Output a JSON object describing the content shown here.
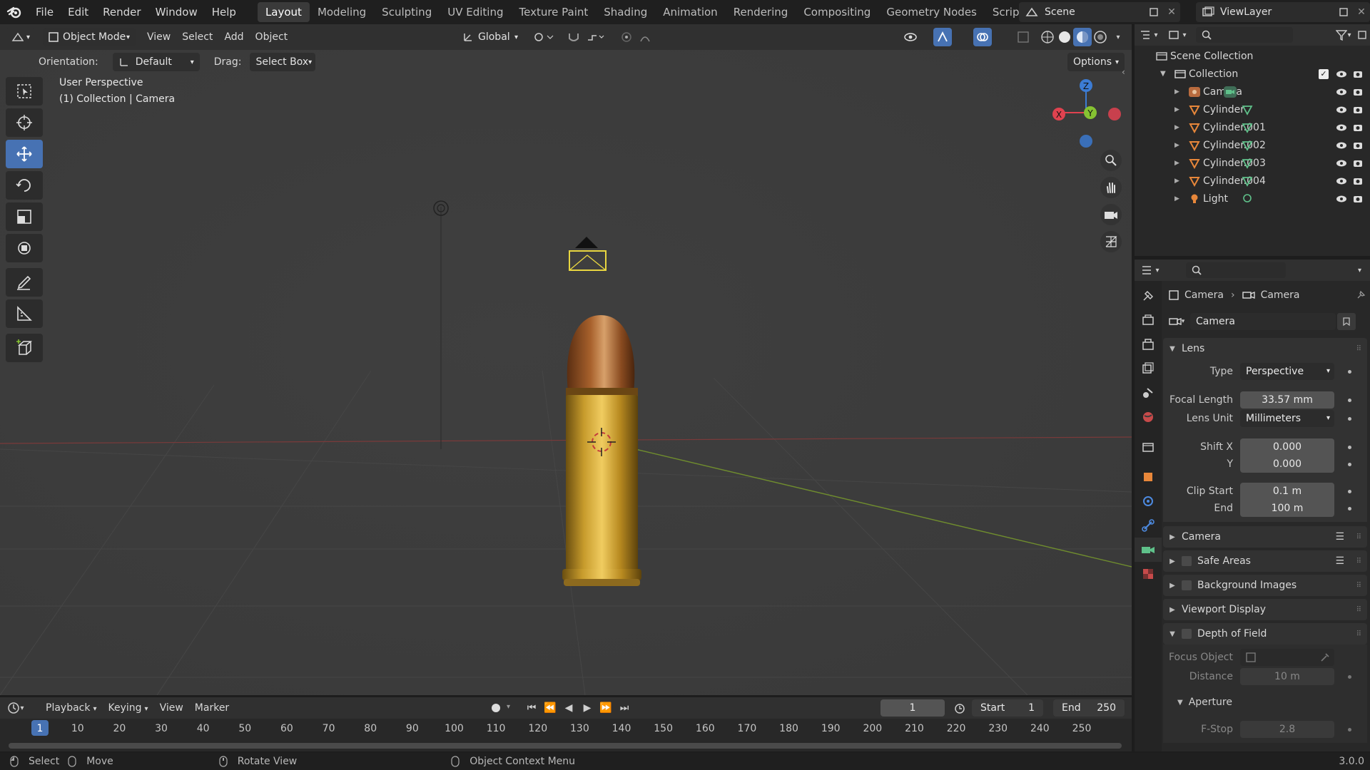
{
  "topbar": {
    "menus": [
      "File",
      "Edit",
      "Render",
      "Window",
      "Help"
    ],
    "workspaces": [
      "Layout",
      "Modeling",
      "Sculpting",
      "UV Editing",
      "Texture Paint",
      "Shading",
      "Animation",
      "Rendering",
      "Compositing",
      "Geometry Nodes",
      "Scripting"
    ],
    "active_workspace": "Layout",
    "add_tab": "+",
    "scene": "Scene",
    "view_layer": "ViewLayer"
  },
  "viewport_header": {
    "mode": "Object Mode",
    "menus": [
      "View",
      "Select",
      "Add",
      "Object"
    ],
    "transform_orientation": "Global"
  },
  "tool_header": {
    "orientation_label": "Orientation:",
    "orientation_value": "Default",
    "drag_label": "Drag:",
    "drag_value": "Select Box",
    "options": "Options"
  },
  "overlay": {
    "line1": "User Perspective",
    "line2": "(1) Collection | Camera"
  },
  "gizmo": {
    "x": "X",
    "y": "Y",
    "z": "Z"
  },
  "outliner": {
    "root": "Scene Collection",
    "collection": "Collection",
    "items": [
      {
        "name": "Camera",
        "type": "camera"
      },
      {
        "name": "Cylinder",
        "type": "mesh"
      },
      {
        "name": "Cylinder.001",
        "type": "mesh"
      },
      {
        "name": "Cylinder.002",
        "type": "mesh"
      },
      {
        "name": "Cylinder.003",
        "type": "mesh"
      },
      {
        "name": "Cylinder.004",
        "type": "mesh"
      },
      {
        "name": "Light",
        "type": "light"
      }
    ]
  },
  "properties": {
    "breadcrumb_object": "Camera",
    "breadcrumb_data": "Camera",
    "datablock": "Camera",
    "lens_panel": "Lens",
    "type_label": "Type",
    "type_value": "Perspective",
    "focal_label": "Focal Length",
    "focal_value": "33.57 mm",
    "lens_unit_label": "Lens Unit",
    "lens_unit_value": "Millimeters",
    "shift_x_label": "Shift X",
    "shift_x_value": "0.000",
    "shift_y_label": "Y",
    "shift_y_value": "0.000",
    "clip_start_label": "Clip Start",
    "clip_start_value": "0.1 m",
    "clip_end_label": "End",
    "clip_end_value": "100 m",
    "panels": [
      "Camera",
      "Safe Areas",
      "Background Images",
      "Viewport Display",
      "Depth of Field"
    ],
    "focus_object_label": "Focus Object",
    "distance_label": "Distance",
    "distance_value": "10 m",
    "aperture_panel": "Aperture",
    "fstop_label": "F-Stop",
    "fstop_value": "2.8"
  },
  "timeline": {
    "menus": [
      "Playback",
      "Keying",
      "View",
      "Marker"
    ],
    "current_frame": "1",
    "start_label": "Start",
    "start_value": "1",
    "end_label": "End",
    "end_value": "250",
    "ticks": [
      "1",
      "10",
      "20",
      "30",
      "40",
      "50",
      "60",
      "70",
      "80",
      "90",
      "100",
      "110",
      "120",
      "130",
      "140",
      "150",
      "160",
      "170",
      "180",
      "190",
      "200",
      "210",
      "220",
      "230",
      "240",
      "250"
    ]
  },
  "statusbar": {
    "select": "Select",
    "move": "Move",
    "rotate": "Rotate View",
    "context": "Object Context Menu",
    "version": "3.0.0"
  },
  "colors": {
    "accent": "#4772b3",
    "x_axis": "#e0424f",
    "y_axis": "#86c232",
    "z_axis": "#3c7cd4",
    "camera_green": "#5fc18a"
  }
}
